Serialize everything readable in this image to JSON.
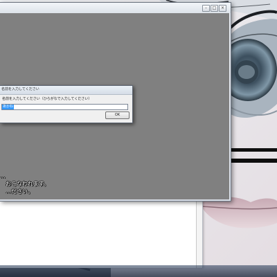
{
  "main_window": {
    "caption_buttons": [
      "minimize",
      "maximize",
      "close"
    ],
    "game_text": "…\n　おこなわれます。\n　…ださい。"
  },
  "dialog": {
    "title": "名前を入力してください",
    "prompt": "名前を入力してください（ひらがなで入力してください）",
    "input_value": "あかね",
    "ok_label": "OK"
  },
  "colors": {
    "game_background": "#808080",
    "selection": "#3399ff"
  }
}
